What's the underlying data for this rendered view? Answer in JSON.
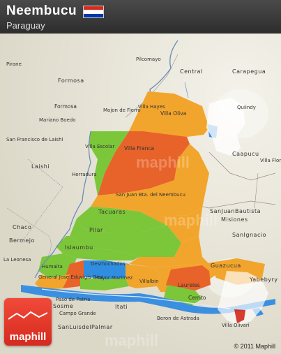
{
  "header": {
    "title": "Neembucu",
    "subtitle": "Paraguay",
    "flag_colors": [
      "#d52b1e",
      "#ffffff",
      "#0038a8"
    ]
  },
  "map": {
    "labels": {
      "pilcomayo": "Pilcomayo",
      "pirane": "Pirane",
      "formosa_dept": "Formosa",
      "formosa_city": "Formosa",
      "central": "Central",
      "carapegua": "Carapegua",
      "mariano_boedo": "Mariano Boedo",
      "mojon_fierro": "Mojon de Fierro",
      "villa_hayes": "Villa Hayes",
      "villa_oliva": "Villa Oliva",
      "quiindy": "Quiindy",
      "san_francisco_laishi": "San Francisco de Laishi",
      "villa_escolar": "Villa Escolar",
      "villa_franca": "Villa Franca",
      "caapucu": "Caapucu",
      "laishi": "Laishi",
      "herradura": "Herradura",
      "villa_florida": "Villa Florida",
      "san_juan_neembucu": "San Juan Bta. del Neembucu",
      "san_juan_bautista": "SanJuanBautista",
      "misiones": "Misiones",
      "tacuaras": "Tacuaras",
      "chaco": "Chaco",
      "pilar": "Pilar",
      "bermejo": "Bermejo",
      "san_ignacio": "SanIgnacio",
      "islaumbu": "Islaumbu",
      "la_leonesa": "La Leonesa",
      "humaita": "Humaita",
      "desmochados": "Desmochados",
      "guazucua": "Guazucua",
      "general_diaz": "General Jose Eduvigis Diaz",
      "mayor_martinez": "Mayor Martinez",
      "villalbin": "Villalbin",
      "laureles": "Laureles",
      "cerrito": "Cerrito",
      "yabebyry": "Yabebyry",
      "paso_de_patria": "Paso de Patria",
      "itati": "Itati",
      "san_cosme": "Sosme",
      "campo_grande": "Campo Grande",
      "san_luis_palmar": "SanLuisdelPalmar",
      "beron_de_astrada": "Beron de Astrada",
      "villa_olivari": "Villa Olivari",
      "n_label": "N"
    },
    "colors": {
      "water": "#3a8fe0",
      "orange": "#f2a52c",
      "red_orange": "#e8632a",
      "green": "#7cc63a",
      "blue": "#2f8ee0",
      "land": "#e6e2d4"
    }
  },
  "logo": {
    "text": "maphill"
  },
  "watermarks": [
    "maphill",
    "maphill",
    "maphill"
  ],
  "copyright": "© 2011 Maphill"
}
